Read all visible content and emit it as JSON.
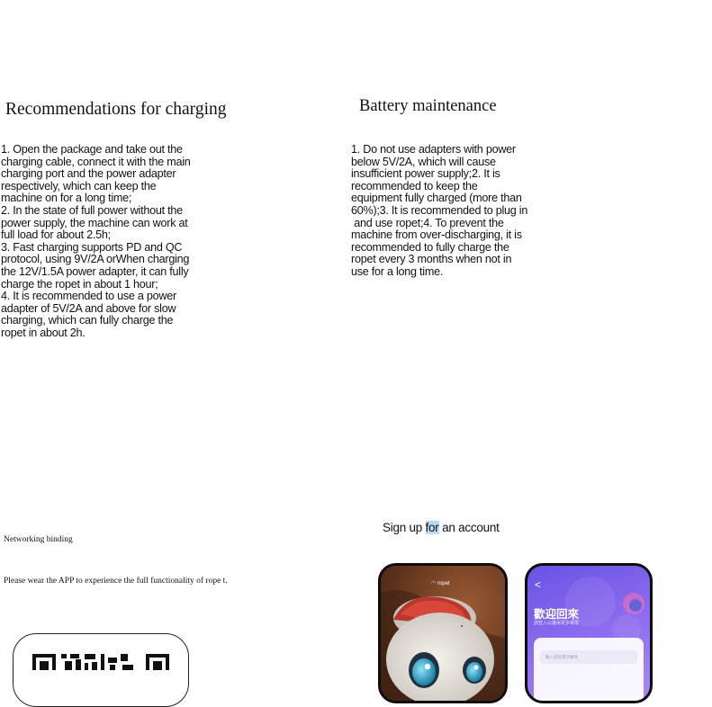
{
  "charging": {
    "title": "Recommendations for charging",
    "lines": [
      "1. Open the package and take out the",
      "charging cable, connect it with the main",
      "charging port and the power adapter",
      "respectively, which can keep the",
      "machine on for a long time;",
      "2. In the state of full power without the",
      "power supply, the machine can work at",
      "full load for about 2.5h;",
      "3. Fast charging supports PD and QC",
      "protocol, using 9V/2A orWhen charging",
      "the 12V/1.5A power adapter, it can fully",
      "charge the ropet in about 1 hour;",
      "4. It is recommended to use a power",
      "adapter of 5V/2A and above for slow",
      "charging, which can fully charge the",
      "ropet in about 2h."
    ]
  },
  "battery": {
    "title": "Battery maintenance",
    "lines": [
      "1. Do not use adapters with power",
      "below 5V/2A, which will cause",
      "insufficient power supply;2. It is",
      "recommended to keep the",
      "equipment fully charged (more than",
      "60%);3. It is recommended to plug in",
      " and use ropet;4. To prevent the",
      "machine from over-discharging, it is",
      "recommended to fully charge the",
      "ropet every 3 months when not in",
      "use for a long time."
    ]
  },
  "networking": {
    "title": "Networking binding",
    "description": "Please wear the APP to experience the full functionality of rope t."
  },
  "signup": {
    "before": "Sign up ",
    "highlight": "for",
    "after": " an account"
  },
  "phones": {
    "left": {
      "brand": "ropet"
    },
    "right": {
      "back": "<",
      "title": "歡迎回來",
      "subtitle": "請登入以獲得更多權限",
      "email_placeholder": "輸入您的電子郵件"
    }
  },
  "colors": {
    "highlight": "#b8dcf5",
    "phone_purple": "#7a5fe8",
    "plush_brown": "#6b3a22"
  }
}
